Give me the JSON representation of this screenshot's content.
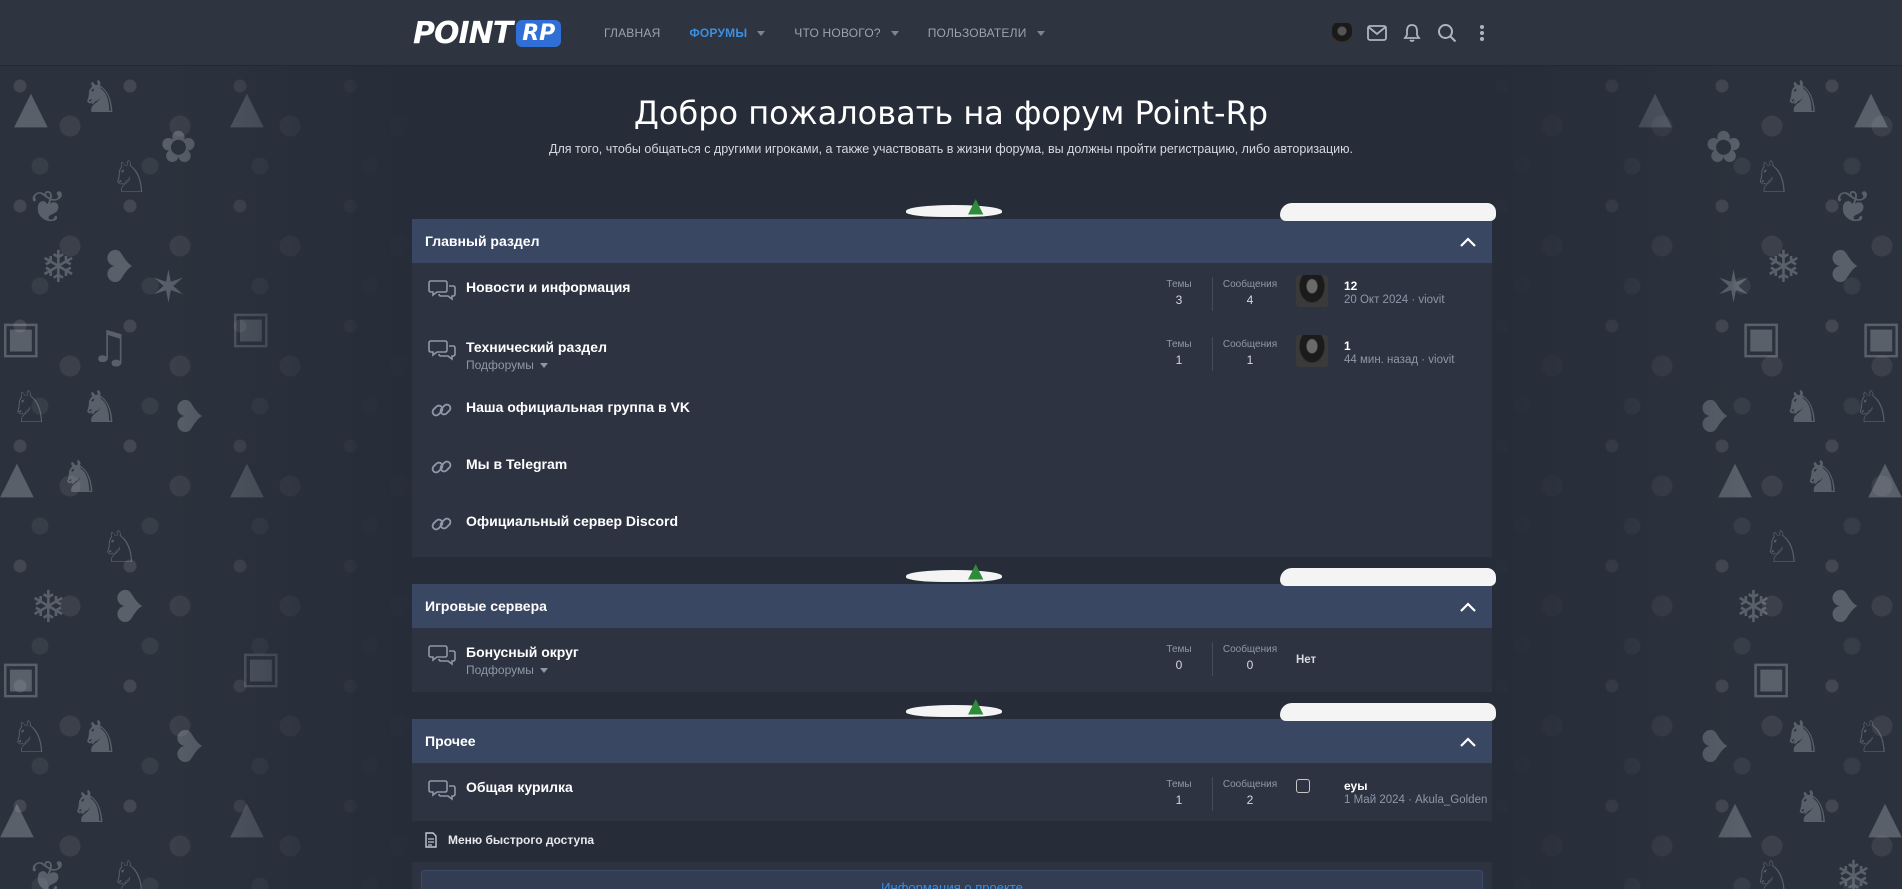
{
  "header": {
    "logo_word": "POINT",
    "logo_badge": "RP",
    "nav": [
      {
        "label": "ГЛАВНАЯ"
      },
      {
        "label": "ФОРУМЫ"
      },
      {
        "label": "ЧТО НОВОГО?"
      },
      {
        "label": "ПОЛЬЗОВАТЕЛИ"
      }
    ]
  },
  "hero": {
    "title": "Добро пожаловать на форум Point-Rp",
    "subtitle": "Для того, чтобы общаться с другими игроками, а также участвовать в жизни форума, вы должны пройти регистрацию, либо авторизацию."
  },
  "labels": {
    "threads": "Темы",
    "messages": "Сообщения",
    "subforums": "Подфорумы",
    "none": "Нет"
  },
  "categories": [
    {
      "title": "Главный раздел",
      "nodes": [
        {
          "title": "Новости и информация",
          "threads": "3",
          "messages": "4",
          "last_title": "12",
          "last_meta": "20 Окт 2024 · viovit"
        },
        {
          "title": "Технический раздел",
          "threads": "1",
          "messages": "1",
          "last_title": "1",
          "last_meta": "44 мин. назад · viovit"
        },
        {
          "title": "Наша официальная группа в VK"
        },
        {
          "title": "Мы в Telegram"
        },
        {
          "title": "Официальный сервер Discord"
        }
      ]
    },
    {
      "title": "Игровые сервера",
      "nodes": [
        {
          "title": "Бонусный округ",
          "threads": "0",
          "messages": "0"
        }
      ]
    },
    {
      "title": "Прочее",
      "nodes": [
        {
          "title": "Общая курилка",
          "threads": "1",
          "messages": "2",
          "last_title": "еуы",
          "last_meta": "1 Май 2024 · Akula_Golden"
        }
      ]
    }
  ],
  "quick_access": "Меню быстрого доступа",
  "info_button": "Информация о проекте",
  "colors": {
    "accent": "#3d8fe0",
    "category_header": "#3a4763",
    "block_bg": "#2d3340",
    "page_bg": "#262c38"
  }
}
